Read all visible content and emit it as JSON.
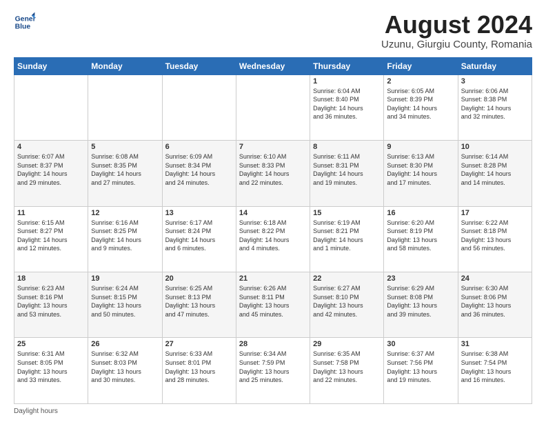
{
  "logo": {
    "line1": "General",
    "line2": "Blue"
  },
  "title": "August 2024",
  "subtitle": "Uzunu, Giurgiu County, Romania",
  "days_of_week": [
    "Sunday",
    "Monday",
    "Tuesday",
    "Wednesday",
    "Thursday",
    "Friday",
    "Saturday"
  ],
  "footer": "Daylight hours",
  "weeks": [
    [
      {
        "date": "",
        "info": ""
      },
      {
        "date": "",
        "info": ""
      },
      {
        "date": "",
        "info": ""
      },
      {
        "date": "",
        "info": ""
      },
      {
        "date": "1",
        "info": "Sunrise: 6:04 AM\nSunset: 8:40 PM\nDaylight: 14 hours\nand 36 minutes."
      },
      {
        "date": "2",
        "info": "Sunrise: 6:05 AM\nSunset: 8:39 PM\nDaylight: 14 hours\nand 34 minutes."
      },
      {
        "date": "3",
        "info": "Sunrise: 6:06 AM\nSunset: 8:38 PM\nDaylight: 14 hours\nand 32 minutes."
      }
    ],
    [
      {
        "date": "4",
        "info": "Sunrise: 6:07 AM\nSunset: 8:37 PM\nDaylight: 14 hours\nand 29 minutes."
      },
      {
        "date": "5",
        "info": "Sunrise: 6:08 AM\nSunset: 8:35 PM\nDaylight: 14 hours\nand 27 minutes."
      },
      {
        "date": "6",
        "info": "Sunrise: 6:09 AM\nSunset: 8:34 PM\nDaylight: 14 hours\nand 24 minutes."
      },
      {
        "date": "7",
        "info": "Sunrise: 6:10 AM\nSunset: 8:33 PM\nDaylight: 14 hours\nand 22 minutes."
      },
      {
        "date": "8",
        "info": "Sunrise: 6:11 AM\nSunset: 8:31 PM\nDaylight: 14 hours\nand 19 minutes."
      },
      {
        "date": "9",
        "info": "Sunrise: 6:13 AM\nSunset: 8:30 PM\nDaylight: 14 hours\nand 17 minutes."
      },
      {
        "date": "10",
        "info": "Sunrise: 6:14 AM\nSunset: 8:28 PM\nDaylight: 14 hours\nand 14 minutes."
      }
    ],
    [
      {
        "date": "11",
        "info": "Sunrise: 6:15 AM\nSunset: 8:27 PM\nDaylight: 14 hours\nand 12 minutes."
      },
      {
        "date": "12",
        "info": "Sunrise: 6:16 AM\nSunset: 8:25 PM\nDaylight: 14 hours\nand 9 minutes."
      },
      {
        "date": "13",
        "info": "Sunrise: 6:17 AM\nSunset: 8:24 PM\nDaylight: 14 hours\nand 6 minutes."
      },
      {
        "date": "14",
        "info": "Sunrise: 6:18 AM\nSunset: 8:22 PM\nDaylight: 14 hours\nand 4 minutes."
      },
      {
        "date": "15",
        "info": "Sunrise: 6:19 AM\nSunset: 8:21 PM\nDaylight: 14 hours\nand 1 minute."
      },
      {
        "date": "16",
        "info": "Sunrise: 6:20 AM\nSunset: 8:19 PM\nDaylight: 13 hours\nand 58 minutes."
      },
      {
        "date": "17",
        "info": "Sunrise: 6:22 AM\nSunset: 8:18 PM\nDaylight: 13 hours\nand 56 minutes."
      }
    ],
    [
      {
        "date": "18",
        "info": "Sunrise: 6:23 AM\nSunset: 8:16 PM\nDaylight: 13 hours\nand 53 minutes."
      },
      {
        "date": "19",
        "info": "Sunrise: 6:24 AM\nSunset: 8:15 PM\nDaylight: 13 hours\nand 50 minutes."
      },
      {
        "date": "20",
        "info": "Sunrise: 6:25 AM\nSunset: 8:13 PM\nDaylight: 13 hours\nand 47 minutes."
      },
      {
        "date": "21",
        "info": "Sunrise: 6:26 AM\nSunset: 8:11 PM\nDaylight: 13 hours\nand 45 minutes."
      },
      {
        "date": "22",
        "info": "Sunrise: 6:27 AM\nSunset: 8:10 PM\nDaylight: 13 hours\nand 42 minutes."
      },
      {
        "date": "23",
        "info": "Sunrise: 6:29 AM\nSunset: 8:08 PM\nDaylight: 13 hours\nand 39 minutes."
      },
      {
        "date": "24",
        "info": "Sunrise: 6:30 AM\nSunset: 8:06 PM\nDaylight: 13 hours\nand 36 minutes."
      }
    ],
    [
      {
        "date": "25",
        "info": "Sunrise: 6:31 AM\nSunset: 8:05 PM\nDaylight: 13 hours\nand 33 minutes."
      },
      {
        "date": "26",
        "info": "Sunrise: 6:32 AM\nSunset: 8:03 PM\nDaylight: 13 hours\nand 30 minutes."
      },
      {
        "date": "27",
        "info": "Sunrise: 6:33 AM\nSunset: 8:01 PM\nDaylight: 13 hours\nand 28 minutes."
      },
      {
        "date": "28",
        "info": "Sunrise: 6:34 AM\nSunset: 7:59 PM\nDaylight: 13 hours\nand 25 minutes."
      },
      {
        "date": "29",
        "info": "Sunrise: 6:35 AM\nSunset: 7:58 PM\nDaylight: 13 hours\nand 22 minutes."
      },
      {
        "date": "30",
        "info": "Sunrise: 6:37 AM\nSunset: 7:56 PM\nDaylight: 13 hours\nand 19 minutes."
      },
      {
        "date": "31",
        "info": "Sunrise: 6:38 AM\nSunset: 7:54 PM\nDaylight: 13 hours\nand 16 minutes."
      }
    ]
  ]
}
